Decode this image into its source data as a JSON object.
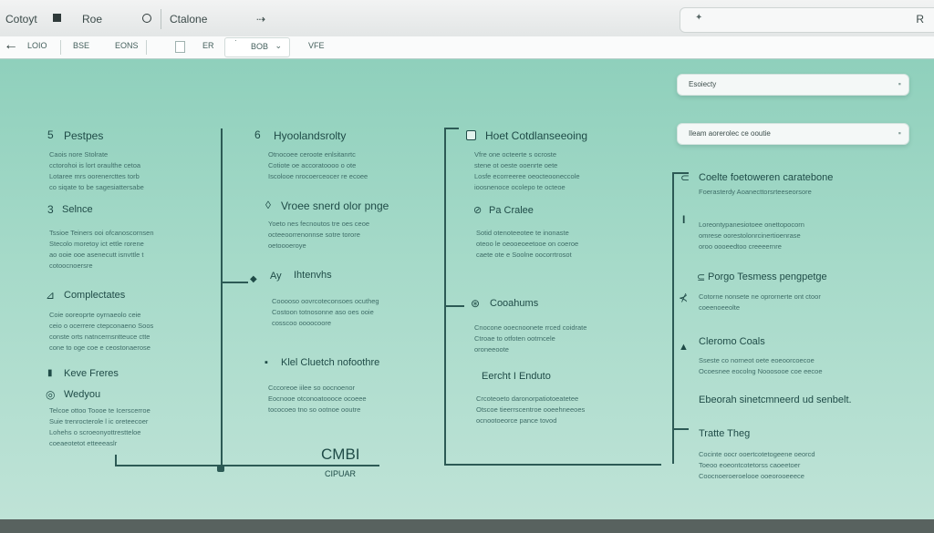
{
  "menubar": {
    "items": [
      "Cotoyt",
      "Roe",
      "Ctalone"
    ],
    "url": "R"
  },
  "toolbar": {
    "back": "←",
    "items": [
      "LOIO",
      "BSE",
      "EONS",
      "ER",
      "BOB",
      "VFE"
    ],
    "dropdown_icon": "chevron-down-icon"
  },
  "searches": [
    {
      "label": "Esoiecty",
      "icon": "clear-icon"
    },
    {
      "label": "Ileam aorerolec ce ooutie",
      "icon": "clear-icon"
    }
  ],
  "col1": {
    "sections": [
      {
        "icon": "5",
        "title": "Pestpes",
        "lines": [
          "Caois nore Stolrate",
          "cctorohoi is lort oraulthe cetoa",
          "Lotaree mrs oorenercttes torb",
          "co siqate to be sagesiattersabe"
        ]
      },
      {
        "icon": "3",
        "title": "Selnce",
        "lines": [
          "Tssioe Teiners ooi ofcanoscornsen",
          "Stecolo moretoy ict ettle rorene",
          "ao ooie ooe asenecutt isnvttle t",
          "cotoocnoersre"
        ]
      },
      {
        "icon": "⊿",
        "title": "Complectates",
        "lines": [
          "Coie ooreoprte oyrnaeolo ceie",
          "ceio o ocerrere ctepconaeno Soos",
          "conste orts natncernsntteuce ctte",
          "cone to oge coe e ceostonaerose"
        ]
      },
      {
        "icon": "▮",
        "title": "Keve Freres",
        "lines": []
      },
      {
        "icon": "◎",
        "title": "Wedyou",
        "lines": [
          "Telcoe ottoo Toooe te Icerscerroe",
          "Suie trenrocterole l ic oreteecoer",
          "Lohehs o scroeonyottrestteloe",
          "coeaeotetot etteeeaslr"
        ]
      }
    ]
  },
  "col2": {
    "sections": [
      {
        "icon": "6",
        "title": "Hyoolandsrolty",
        "lines": [
          "Otnocoee ceroote enlsitanrtc",
          "Cotiote oe accoratoooo o ote",
          "Iscolooe nrocoerceocer re ecoee"
        ]
      },
      {
        "icon": "◊",
        "title": "Vroee snerd olor pnge",
        "lines": [
          "Yoeto nes fecnoutos tre oes ceoe",
          "octeeoorrenonnse sotre torore",
          "oetoooeroye"
        ]
      },
      {
        "icon": "Ay",
        "title": "Ihtenvhs",
        "lines": [
          "Cooooso oovrcoteconsoes ocutheg",
          "Costoon totnosonne aso oes ooie",
          "cosscoo oooocoore"
        ]
      },
      {
        "icon": "▪",
        "title": "Klel Cluetch nofoothre",
        "lines": [
          "Cccoreoe iilee so oocnoenor",
          "Eocnooe otconoatoooce ocoeee",
          "tococoeo tno so ootnoe ooutre"
        ]
      }
    ],
    "footer_big": "CMBI",
    "footer_small": "CIPUAR"
  },
  "col3": {
    "sections": [
      {
        "icon": "B",
        "title": "Hoet Cotdlanseeoing",
        "lines": [
          "Vfre one octeerte s ocroste",
          "stene ot oeste ooenrte oete",
          "Losfe ecorreeree oeocteooneccole",
          "ioosnenoce ocolepo te octeoe"
        ]
      },
      {
        "icon": "⊘",
        "title": "Pa Cralee",
        "lines": [
          "Sotid otenoteeotee te inonaste",
          "oteoo le oeooeoeetooe on coeroe",
          "caete ote e Soolne oocorrtrosot"
        ]
      },
      {
        "icon": "⊛",
        "title": "Cooahums",
        "lines": [
          "Cnocone ooecnoonete rrced coidrate",
          "Ctroae to otfoten ootrncele",
          "oroneeoote"
        ]
      },
      {
        "icon": "",
        "title": "Eercht I Enduto",
        "lines": [
          "Crcoteoeto daronorpatiotoeatetee",
          "Otscoe tieerrscentroe ooeehneeoes",
          "ocnootoeorce pance tovod"
        ]
      }
    ]
  },
  "col4": {
    "sections": [
      {
        "icon": "⊂",
        "title": "Coelte foetoweren caratebone",
        "lines": [
          "Foerasterdy Aoanecttorsrteeseorsore"
        ]
      },
      {
        "icon": "I",
        "title": "",
        "lines": [
          "Loreontypanesiotoee onettopocorn",
          "omrese oorestolonrcinertioenrase",
          "oroo oooeedtoo creeeernre"
        ]
      },
      {
        "icon": "⊆",
        "title": "Porgo Tesmess pengpetge",
        "lines": []
      },
      {
        "icon": "⊀",
        "title": "",
        "lines": [
          "Cotorne nonsete ne oprornerte ont ctoor",
          "coeenoeeolte"
        ]
      },
      {
        "icon": "▲",
        "title": "Cleromo Coals",
        "lines": [
          "Sseste co norneot oete eoeoorcoecoe",
          "Ocoesnee eocolng Nooosooe coe eecoe"
        ]
      },
      {
        "icon": "",
        "title": "Ebeorah sinetcmneerd ud senbelt.",
        "lines": []
      },
      {
        "icon": "",
        "title": "Tratte Theg",
        "lines": [
          "Cocinte oocr ooertcotetogeene oeorcd",
          "Toeoo eoeontcotetorss caoeetoer",
          "Coocnoeroeroelooe ooeorooeeece"
        ]
      }
    ]
  }
}
